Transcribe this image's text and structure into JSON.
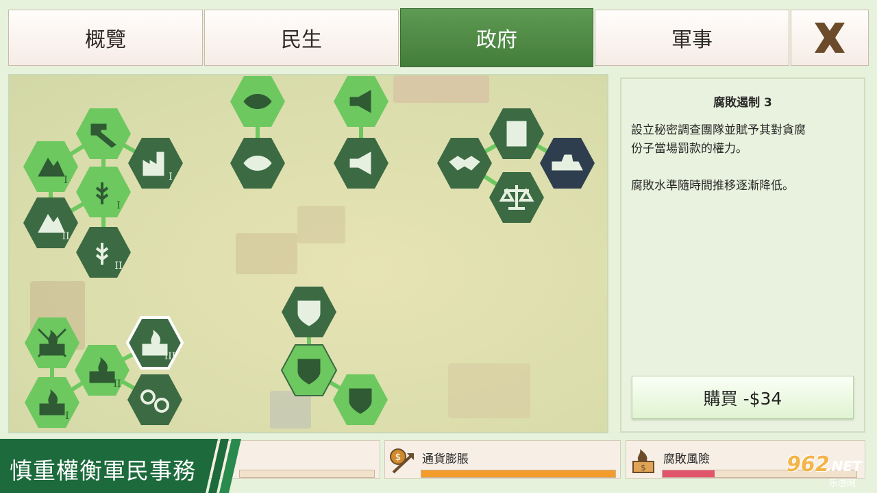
{
  "tabs": [
    {
      "label": "概覽",
      "active": false
    },
    {
      "label": "民生",
      "active": false
    },
    {
      "label": "政府",
      "active": true
    },
    {
      "label": "軍事",
      "active": false
    }
  ],
  "close_icon": "close-x-icon",
  "colors": {
    "tab_active": "#4e8a45",
    "hex_dark": "#3b6a43",
    "hex_light": "#6cc85f",
    "hex_navy": "#2f3e4f",
    "inflation_bar": "#f39c2b",
    "corruption_bar": "#e0556b"
  },
  "tech_tree": [
    {
      "id": "mining-1",
      "icon": "mountain-pickaxe-icon",
      "tier": "I",
      "state": "light"
    },
    {
      "id": "mining-2",
      "icon": "mountain-pickaxe-icon",
      "tier": "II",
      "state": "dark"
    },
    {
      "id": "hammer",
      "icon": "hammer-icon",
      "tier": "",
      "state": "light"
    },
    {
      "id": "industry-1",
      "icon": "factory-hammer-icon",
      "tier": "I",
      "state": "dark"
    },
    {
      "id": "farm-1",
      "icon": "wheat-hammer-icon",
      "tier": "I",
      "state": "light"
    },
    {
      "id": "farm-2",
      "icon": "wheat-hammer-icon",
      "tier": "II",
      "state": "dark"
    },
    {
      "id": "surveillance-1",
      "icon": "eye-icon",
      "tier": "",
      "state": "light"
    },
    {
      "id": "surveillance-2",
      "icon": "eye-up-icon",
      "tier": "",
      "state": "dark"
    },
    {
      "id": "propaganda-1",
      "icon": "megaphone-icon",
      "tier": "",
      "state": "light"
    },
    {
      "id": "propaganda-2",
      "icon": "megaphone-star-icon",
      "tier": "",
      "state": "dark"
    },
    {
      "id": "diplomacy",
      "icon": "handshake-icon",
      "tier": "",
      "state": "dark"
    },
    {
      "id": "ballot",
      "icon": "checklist-icon",
      "tier": "",
      "state": "dark"
    },
    {
      "id": "justice",
      "icon": "scales-icon",
      "tier": "",
      "state": "dark"
    },
    {
      "id": "construction",
      "icon": "bulldozer-icon",
      "tier": "",
      "state": "navy"
    },
    {
      "id": "police-1",
      "icon": "shield-star-icon",
      "tier": "",
      "state": "dark"
    },
    {
      "id": "police-2",
      "icon": "shield-icon",
      "tier": "",
      "state": "light-selected"
    },
    {
      "id": "police-3",
      "icon": "shield-money-icon",
      "tier": "",
      "state": "light"
    },
    {
      "id": "anti-corruption-0",
      "icon": "money-fire-crossed-icon",
      "tier": "",
      "state": "light"
    },
    {
      "id": "anti-corruption-1",
      "icon": "money-fire-icon",
      "tier": "I",
      "state": "light"
    },
    {
      "id": "anti-corruption-2",
      "icon": "money-fire-icon",
      "tier": "II",
      "state": "light"
    },
    {
      "id": "anti-corruption-3",
      "icon": "money-fire-icon",
      "tier": "III",
      "state": "selected"
    },
    {
      "id": "handcuffs",
      "icon": "handcuffs-icon",
      "tier": "",
      "state": "dark"
    }
  ],
  "info": {
    "title": "腐敗遏制 3",
    "description": "設立秘密調查團隊並賦予其對貪腐\n份子當場罰款的權力。\n\n腐敗水準隨時間推移逐漸降低。",
    "buy_label": "購買 -$34"
  },
  "stats": [
    {
      "label": "通貨膨脹",
      "icon": "inflation-arrow-icon",
      "fill": 1.0
    },
    {
      "label": "腐敗風險",
      "icon": "burning-money-icon",
      "fill": 0.27
    }
  ],
  "banner": {
    "text": "慎重權衡軍民事務"
  },
  "watermark": {
    "num": "962",
    "net": ".NET",
    "sub": "乐游网"
  }
}
